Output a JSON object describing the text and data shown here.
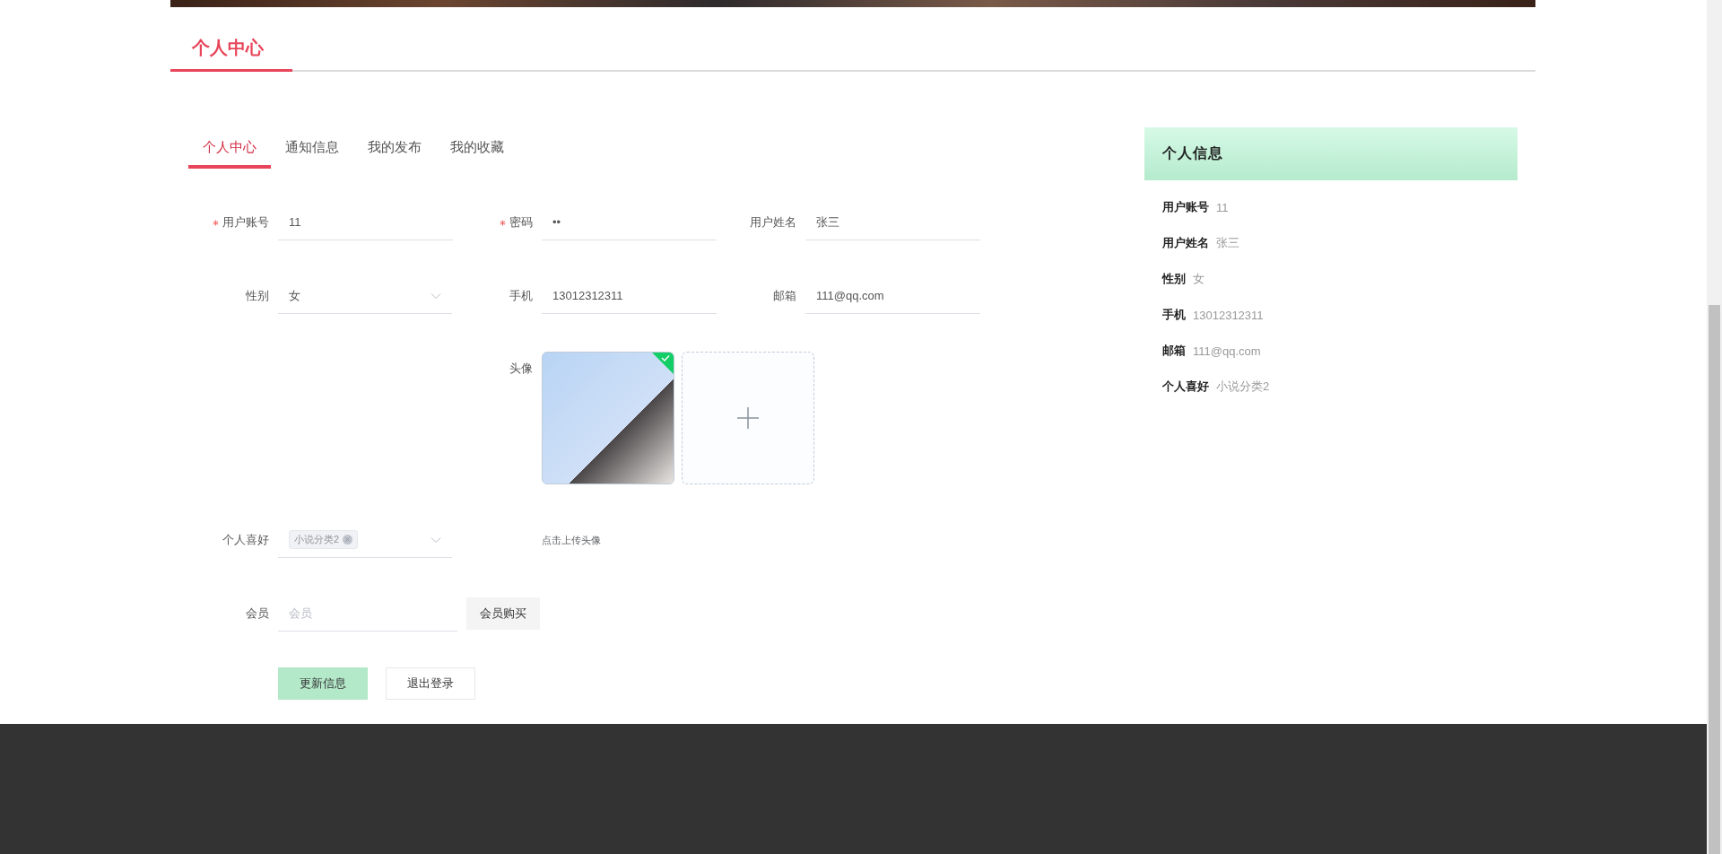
{
  "page_title": "个人中心",
  "tabs": [
    {
      "label": "个人中心",
      "selected": true
    },
    {
      "label": "通知信息",
      "selected": false
    },
    {
      "label": "我的发布",
      "selected": false
    },
    {
      "label": "我的收藏",
      "selected": false
    }
  ],
  "form": {
    "rows": [
      [
        {
          "label": "用户账号",
          "required": true,
          "kind": "input",
          "value": "11"
        },
        {
          "label": "密码",
          "required": true,
          "kind": "input",
          "value": "••"
        },
        {
          "label": "用户姓名",
          "required": false,
          "kind": "input",
          "value": "张三"
        }
      ],
      [
        {
          "label": "性别",
          "required": false,
          "kind": "select",
          "value": "女"
        },
        {
          "label": "手机",
          "required": false,
          "kind": "input",
          "value": "13012312311"
        },
        {
          "label": "邮箱",
          "required": false,
          "kind": "input",
          "value": "111@qq.com"
        }
      ]
    ],
    "avatar": {
      "label": "头像",
      "uploaded": true,
      "hint": "点击上传头像"
    },
    "hobby": {
      "label": "个人喜好",
      "tags": [
        "小说分类2"
      ]
    },
    "member": {
      "label": "会员",
      "placeholder": "会员",
      "button": "会员购买"
    },
    "buttons": [
      {
        "label": "更新信息",
        "kind": "primary"
      },
      {
        "label": "退出登录",
        "kind": "default"
      }
    ]
  },
  "info_panel": {
    "title": "个人信息",
    "items": [
      {
        "label": "用户账号",
        "value": "11"
      },
      {
        "label": "用户姓名",
        "value": "张三"
      },
      {
        "label": "性别",
        "value": "女"
      },
      {
        "label": "手机",
        "value": "13012312311"
      },
      {
        "label": "邮箱",
        "value": "111@qq.com"
      },
      {
        "label": "个人喜好",
        "value": "小说分类2"
      }
    ]
  }
}
